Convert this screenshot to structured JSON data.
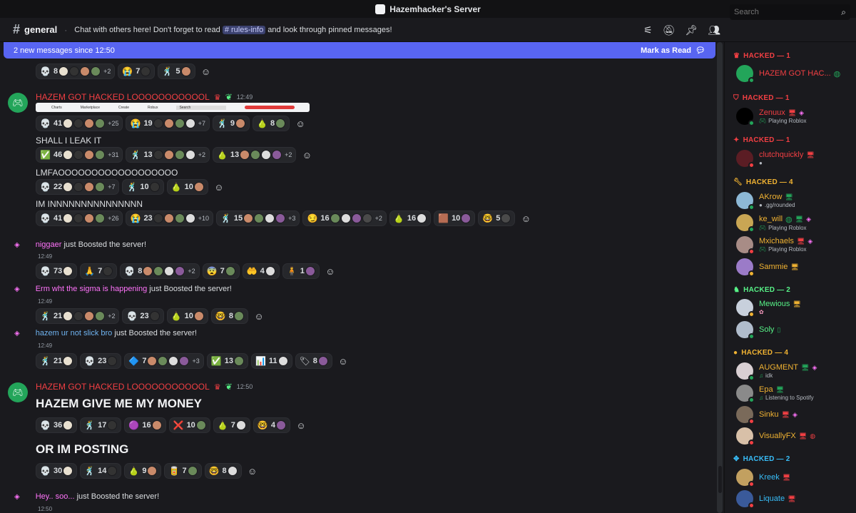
{
  "window": {
    "title": "Hazemhacker's Server"
  },
  "channel": {
    "name": "general",
    "topic_prefix": "Chat with others here! Don't forget to read ",
    "topic_mention": "# rules-info",
    "topic_suffix": " and look through pinned messages!"
  },
  "search": {
    "placeholder": "Search"
  },
  "newbar": {
    "text": "2 new messages since 12:50",
    "action": "Mark as Read"
  },
  "messages": {
    "m1": {
      "author": "HAZEM GOT HACKED LOOOOOOOOOOOL",
      "time": "12:49",
      "embed": [
        "Charts",
        "Marketplace",
        "Create",
        "Robux",
        "Search"
      ]
    },
    "m2": {
      "text": "SHALL I LEAK IT"
    },
    "m3": {
      "text": "LMFAOOOOOOOOOOOOOOOOOO"
    },
    "m4": {
      "text": "IM INNNNNNNNNNNNNNN"
    },
    "b1": {
      "name": "niggaer",
      "suffix": " just Boosted the server!",
      "time": "12:49"
    },
    "b2": {
      "name": "Erm wht the sigma is happening",
      "suffix": " just Boosted the server!",
      "time": "12:49"
    },
    "b3": {
      "name": "hazem ur not slick bro",
      "suffix": " just Boosted the server!",
      "time": "12:49"
    },
    "m5": {
      "author": "HAZEM GOT HACKED LOOOOOOOOOOOL",
      "time": "12:50",
      "text": "HAZEM GIVE ME MY MONEY"
    },
    "m6": {
      "text": "OR IM POSTING"
    },
    "b4": {
      "name": "Hey.. soo...",
      "suffix": " just Boosted the server!",
      "time": "12:50"
    }
  },
  "reactions": {
    "r0": [
      {
        "e": "💀",
        "c": "8",
        "more": "+2"
      },
      {
        "e": "😭",
        "c": "7"
      },
      {
        "e": "🕺",
        "c": "5"
      }
    ],
    "r1": [
      {
        "e": "💀",
        "c": "41",
        "more": "+25"
      },
      {
        "e": "😭",
        "c": "19",
        "more": "+7"
      },
      {
        "e": "🕺",
        "c": "9"
      },
      {
        "e": "🍐",
        "c": "8"
      }
    ],
    "r2": [
      {
        "e": "✅",
        "c": "46",
        "more": "+31"
      },
      {
        "e": "🕺",
        "c": "13",
        "more": "+2"
      },
      {
        "e": "🍐",
        "c": "13",
        "more": "+2"
      }
    ],
    "r3": [
      {
        "e": "💀",
        "c": "22",
        "more": "+7"
      },
      {
        "e": "🕺",
        "c": "10"
      },
      {
        "e": "🍐",
        "c": "10"
      }
    ],
    "r4": [
      {
        "e": "💀",
        "c": "41",
        "more": "+26"
      },
      {
        "e": "😭",
        "c": "23",
        "more": "+10"
      },
      {
        "e": "🕺",
        "c": "15",
        "more": "+3"
      },
      {
        "e": "😏",
        "c": "16",
        "more": "+2"
      },
      {
        "e": "🍐",
        "c": "16"
      },
      {
        "e": "🟫",
        "c": "10"
      },
      {
        "e": "🤓",
        "c": "5"
      }
    ],
    "r5": [
      {
        "e": "💀",
        "c": "73"
      },
      {
        "e": "🙏",
        "c": "7"
      },
      {
        "e": "💀",
        "c": "8",
        "more": "+2"
      },
      {
        "e": "😨",
        "c": "7"
      },
      {
        "e": "🤲",
        "c": "4"
      },
      {
        "e": "🧍",
        "c": "1"
      }
    ],
    "r6": [
      {
        "e": "🕺",
        "c": "21",
        "more": "+2"
      },
      {
        "e": "💀",
        "c": "23"
      },
      {
        "e": "🍐",
        "c": "10"
      },
      {
        "e": "🤓",
        "c": "8"
      }
    ],
    "r7": [
      {
        "e": "🕺",
        "c": "21"
      },
      {
        "e": "💀",
        "c": "23"
      },
      {
        "e": "🔷",
        "c": "7",
        "more": "+3"
      },
      {
        "e": "✅",
        "c": "13"
      },
      {
        "e": "📊",
        "c": "11"
      },
      {
        "e": "🏷",
        "c": "8"
      }
    ],
    "r8": [
      {
        "e": "💀",
        "c": "36"
      },
      {
        "e": "🕺",
        "c": "17"
      },
      {
        "e": "🟣",
        "c": "16"
      },
      {
        "e": "❌",
        "c": "10"
      },
      {
        "e": "🍐",
        "c": "7"
      },
      {
        "e": "🤓",
        "c": "4"
      }
    ],
    "r9": [
      {
        "e": "💀",
        "c": "30"
      },
      {
        "e": "🕺",
        "c": "14"
      },
      {
        "e": "🍐",
        "c": "9"
      },
      {
        "e": "🥫",
        "c": "7"
      },
      {
        "e": "🤓",
        "c": "8"
      }
    ]
  },
  "members": {
    "roles": [
      {
        "label": "HACKED — 1",
        "color": "#f23f43"
      },
      {
        "label": "HACKED — 1",
        "color": "#f23f43"
      },
      {
        "label": "HACKED — 1",
        "color": "#f23f43"
      },
      {
        "label": "HACKED — 4",
        "color": "#f0b232"
      },
      {
        "label": "HACKED — 2",
        "color": "#57f287"
      },
      {
        "label": "HACKED — 4",
        "color": "#f0b232"
      },
      {
        "label": "HACKED — 2",
        "color": "#38bdf8"
      }
    ],
    "list": [
      {
        "name": "HAZEM GOT HAC...",
        "act": ""
      },
      {
        "name": "Zenuux",
        "act": "Playing Roblox"
      },
      {
        "name": "clutchquickly",
        "act": ""
      },
      {
        "name": "AKrow",
        "act": ".gg/rounded"
      },
      {
        "name": "ke_will",
        "act": "Playing Roblox"
      },
      {
        "name": "Mxichaels",
        "act": "Playing Roblox"
      },
      {
        "name": "Sammie",
        "act": ""
      },
      {
        "name": "Mewious",
        "act": ""
      },
      {
        "name": "Soly",
        "act": ""
      },
      {
        "name": "AUGMENT",
        "act": "idk"
      },
      {
        "name": "Epa",
        "act": "Listening to Spotify"
      },
      {
        "name": "Sinku",
        "act": ""
      },
      {
        "name": "VisuallyFX",
        "act": ""
      },
      {
        "name": "Kreek",
        "act": ""
      },
      {
        "name": "Liquate",
        "act": ""
      }
    ]
  },
  "colors": {
    "accent": "#5865f2",
    "hacked_red": "#f23f43",
    "boost_pink": "#ff73fa",
    "online": "#23a55a",
    "dnd": "#f23f43"
  }
}
